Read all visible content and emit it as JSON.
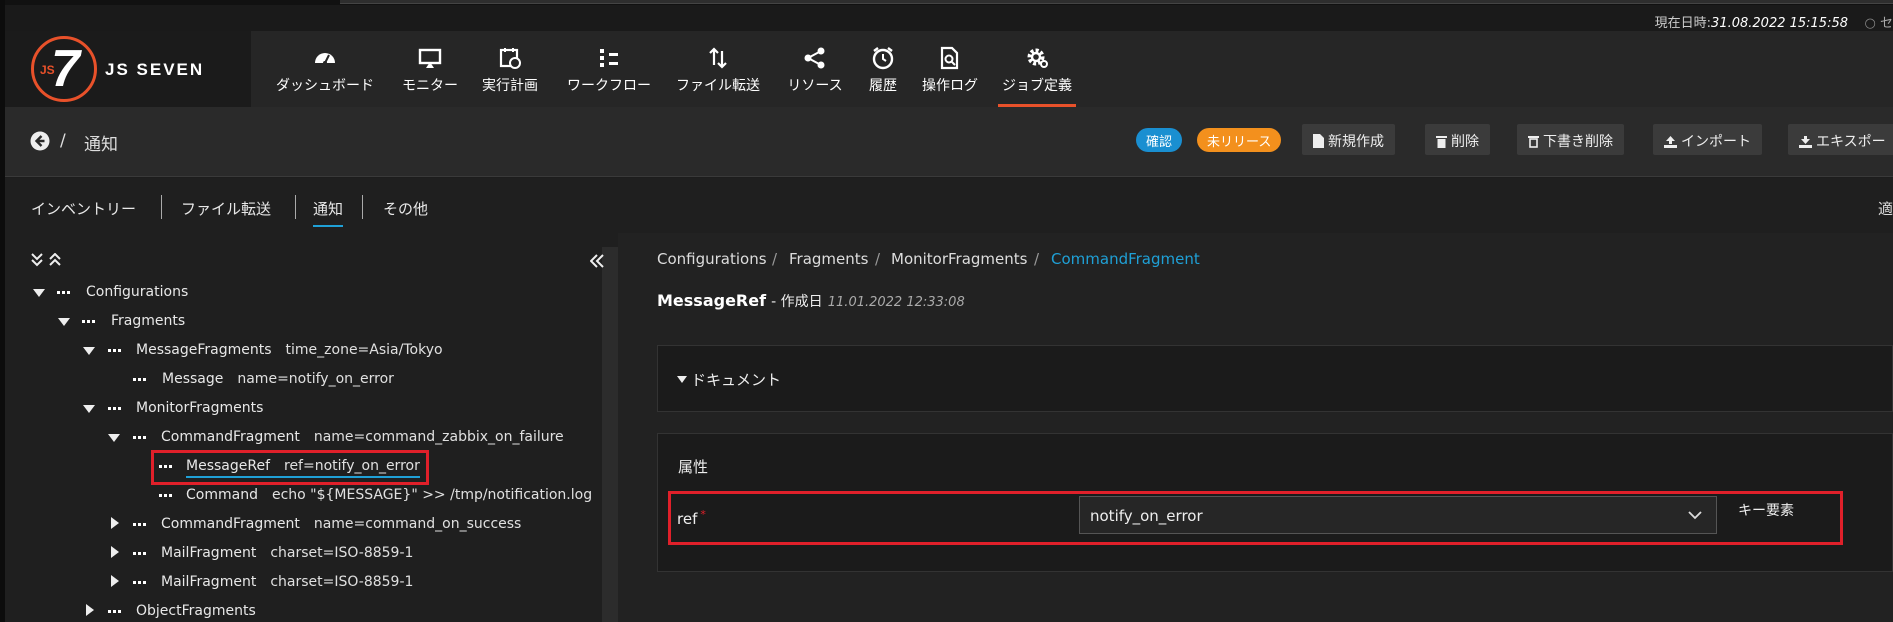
{
  "timebar": {
    "label": "現在日時:",
    "value": "31.08.2022 15:15:58",
    "cut": "セ"
  },
  "logo": {
    "brand": "JS SEVEN",
    "mark_small": "JS",
    "mark_big": "7"
  },
  "nav": [
    {
      "label": "ダッシュボード",
      "icon": "dashboard-gauge-icon"
    },
    {
      "label": "モニター",
      "icon": "monitor-icon"
    },
    {
      "label": "実行計画",
      "icon": "calendar-clock-icon"
    },
    {
      "label": "ワークフロー",
      "icon": "workflow-icon"
    },
    {
      "label": "ファイル転送",
      "icon": "file-transfer-icon"
    },
    {
      "label": "リソース",
      "icon": "share-icon"
    },
    {
      "label": "履歴",
      "icon": "alarm-clock-icon"
    },
    {
      "label": "操作ログ",
      "icon": "log-search-icon"
    },
    {
      "label": "ジョブ定義",
      "icon": "gear-icon",
      "active": true
    }
  ],
  "page": {
    "slash": "/",
    "title": "通知"
  },
  "badges": {
    "confirm": "確認",
    "unreleased": "未リリース"
  },
  "toolbar": {
    "new": "新規作成",
    "delete": "削除",
    "delete_draft": "下書き削除",
    "import": "インポート",
    "export": "エキスポー"
  },
  "tabs": {
    "inventory": "インベントリー",
    "file_transfer": "ファイル転送",
    "notification": "通知",
    "other": "その他",
    "cut": "適"
  },
  "tree": {
    "n1": {
      "label": "Configurations"
    },
    "n2": {
      "label": "Fragments"
    },
    "n3": {
      "label": "MessageFragments",
      "attr": "time_zone=Asia/Tokyo"
    },
    "n4": {
      "label": "Message",
      "attr": "name=notify_on_error"
    },
    "n5": {
      "label": "MonitorFragments"
    },
    "n6": {
      "label": "CommandFragment",
      "attr": "name=command_zabbix_on_failure"
    },
    "n7": {
      "label": "MessageRef",
      "attr": "ref=notify_on_error"
    },
    "n8": {
      "label": "Command",
      "attr": "echo \"${MESSAGE}\" >> /tmp/notification.log"
    },
    "n9": {
      "label": "CommandFragment",
      "attr": "name=command_on_success"
    },
    "n10": {
      "label": "MailFragment",
      "attr": "charset=ISO-8859-1"
    },
    "n11": {
      "label": "MailFragment",
      "attr": "charset=ISO-8859-1"
    },
    "n12": {
      "label": "ObjectFragments"
    }
  },
  "detail": {
    "breadcrumb": [
      "Configurations",
      "Fragments",
      "MonitorFragments",
      "CommandFragment"
    ],
    "sep": "/",
    "heading": "MessageRef",
    "created_label": "- 作成日",
    "created_date": "11.01.2022 12:33:08",
    "doc_section": "ドキュメント",
    "attr_section": "属性",
    "ref_label": "ref",
    "required_mark": "*",
    "ref_value": "notify_on_error",
    "key_element": "キー要素"
  },
  "colors": {
    "accent": "#e8512a",
    "link": "#1fa0d6",
    "highlight": "#e0202a",
    "badge_blue": "#1a8fd1",
    "badge_orange": "#f3901d"
  }
}
